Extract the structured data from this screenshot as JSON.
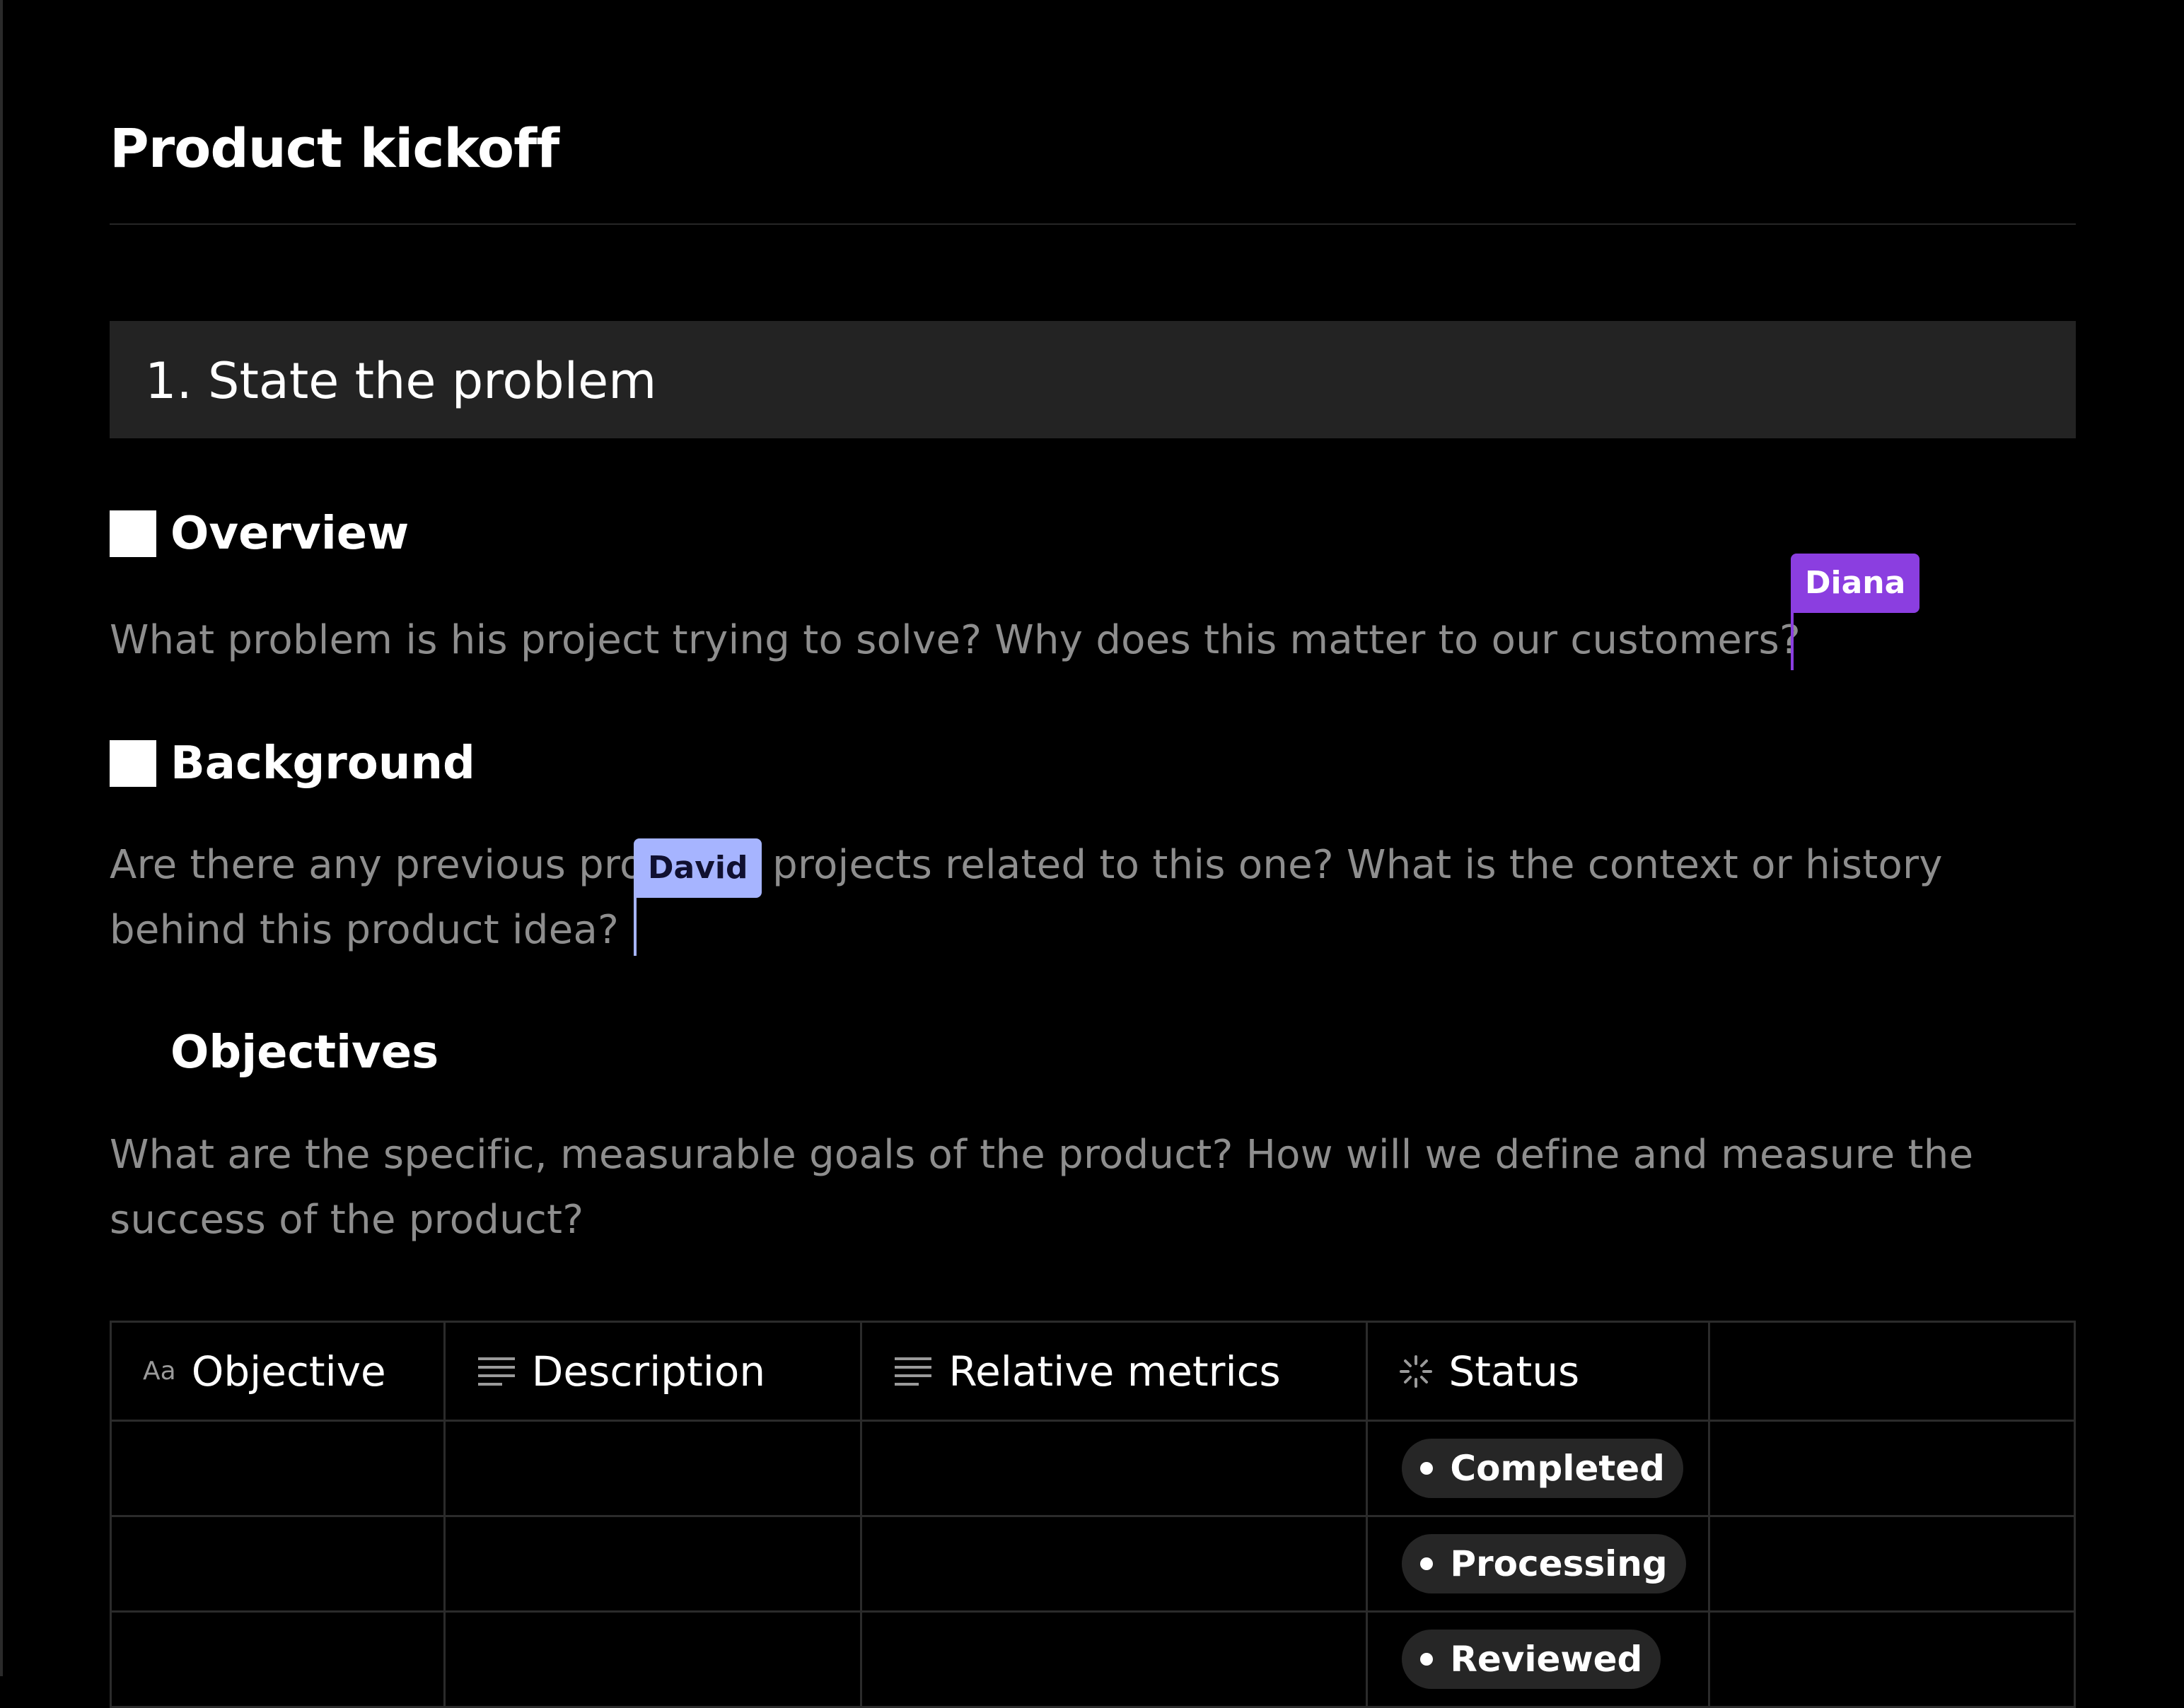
{
  "page": {
    "title": "Product kickoff"
  },
  "section": {
    "title": "1. State the problem"
  },
  "overview": {
    "heading": "Overview",
    "text": "What problem is his project trying to solve? Why does this matter to our customers?"
  },
  "background": {
    "heading": "Background",
    "text_part1": "Are there any previous pro",
    "text_part2": "r projects related to this one? What is the context or history",
    "text_line2": "behind this product idea?"
  },
  "objectives": {
    "heading": "Objectives",
    "text_line1": "What are the specific, measurable goals of the product? How will we define and measure the",
    "text_line2": "success of the product?"
  },
  "collaborators": {
    "diana": {
      "name": "Diana",
      "color": "#8b3ee0"
    },
    "david": {
      "name": "David",
      "color": "#a6b4ff"
    }
  },
  "table": {
    "columns": [
      {
        "label": "Objective",
        "icon": "text-format-icon"
      },
      {
        "label": "Description",
        "icon": "lines-icon"
      },
      {
        "label": "Relative metrics",
        "icon": "lines-icon"
      },
      {
        "label": "Status",
        "icon": "loading-spinner-icon"
      },
      {
        "label": "",
        "icon": ""
      }
    ],
    "icon_label_aa": "Aa",
    "rows": [
      {
        "objective": "",
        "description": "",
        "metrics": "",
        "status": "Completed"
      },
      {
        "objective": "",
        "description": "",
        "metrics": "",
        "status": "Processing"
      },
      {
        "objective": "",
        "description": "",
        "metrics": "",
        "status": "Reviewed"
      }
    ]
  }
}
